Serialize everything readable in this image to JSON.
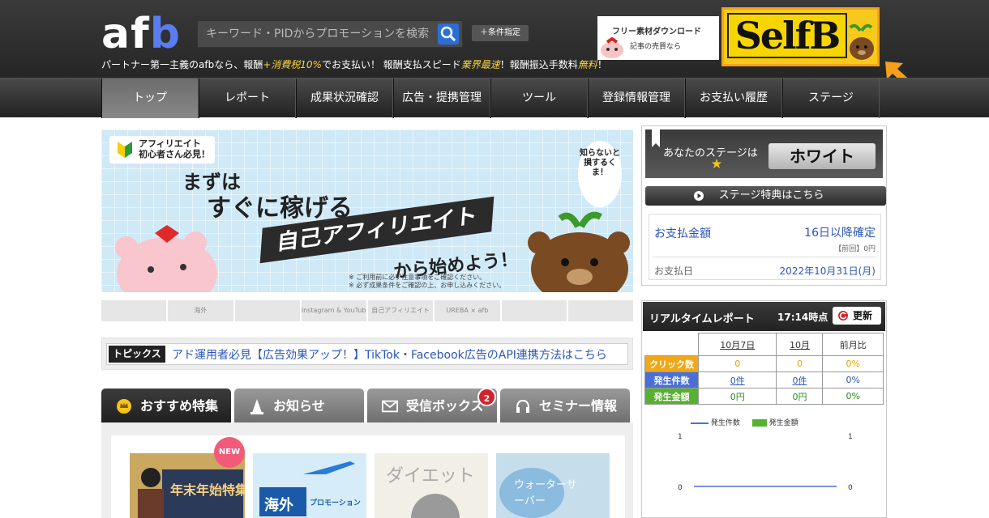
{
  "header": {
    "logo": "afb",
    "search_placeholder": "キーワード・PIDからプロモーションを検索",
    "condition_button": "＋条件指定",
    "tagline_1": "パートナー第一主義のafbなら、報酬",
    "tagline_2": "+消費税10%",
    "tagline_3": "でお支払い！ 報酬支払スピード",
    "tagline_4": "業界最速",
    "tagline_5": "！報酬振込手数料",
    "tagline_6": "無料",
    "tagline_7": "！",
    "banner1_line1": "フリー素材ダウンロード",
    "banner1_line2": "記事の売買なら",
    "banner2_text": "SelfB"
  },
  "nav": [
    "トップ",
    "レポート",
    "成果状況確認",
    "広告・提携管理",
    "ツール",
    "登録情報管理",
    "お支払い履歴",
    "ステージ"
  ],
  "hero": {
    "badge": "アフィリエイト\n初心者さん必見！",
    "line1": "まずは",
    "line2": "すぐに稼げる",
    "line3": "自己アフィリエイト",
    "line4": "から始めよう！",
    "bubble": "知らないと損するくま！",
    "note1": "※ ご利用前に必ず注意事項をご確認ください。",
    "note2": "※ 必ず成果条件をご確認の上、お申し込みください。"
  },
  "strip": [
    "海外",
    "Instagram & YouTube",
    "UREBA × afb",
    "自己アフィリエイト"
  ],
  "topics": {
    "tag": "トピックス",
    "text": "アド運用者必見【広告効果アップ！】TikTok・Facebook広告のAPI連携方法はこちら"
  },
  "tabs": [
    "おすすめ特集",
    "お知らせ",
    "受信ボックス",
    "セミナー情報"
  ],
  "inbox_badge": "2",
  "cards": [
    {
      "title": "年末年始特集",
      "tag": "NEW"
    },
    {
      "title": "海外",
      "sub": "プロモーション"
    },
    {
      "title": "ダイエット"
    },
    {
      "title": "ウォーターサーバー"
    }
  ],
  "stage": {
    "label": "あなたのステージは",
    "value": "ホワイト",
    "button": "ステージ特典はこちら"
  },
  "payment": {
    "label": "お支払金額",
    "value": "16日以降確定",
    "previous": "【前回】0円",
    "date_label": "お支払日",
    "date_value": "2022年10月31日(月)"
  },
  "realtime": {
    "title": "リアルタイムレポート",
    "time": "17:14時点",
    "update_button": "更新",
    "columns": [
      "10月7日",
      "10月",
      "前月比"
    ],
    "rows": [
      {
        "label": "クリック数",
        "values": [
          "0",
          "0",
          "0%"
        ]
      },
      {
        "label": "発生件数",
        "values": [
          "0件",
          "0件",
          "0%"
        ]
      },
      {
        "label": "発生金額",
        "values": [
          "0円",
          "0円",
          "0%"
        ]
      }
    ],
    "legend_1": "発生件数",
    "legend_2": "発生金額",
    "axis_left_top": "1",
    "axis_left_mid": "0",
    "axis_right_top": "1",
    "axis_right_mid": "0"
  },
  "colors": {
    "click": "#f0a818",
    "count": "#4a6fd8",
    "amount": "#58b030",
    "accent_blue": "#2a55b8"
  }
}
